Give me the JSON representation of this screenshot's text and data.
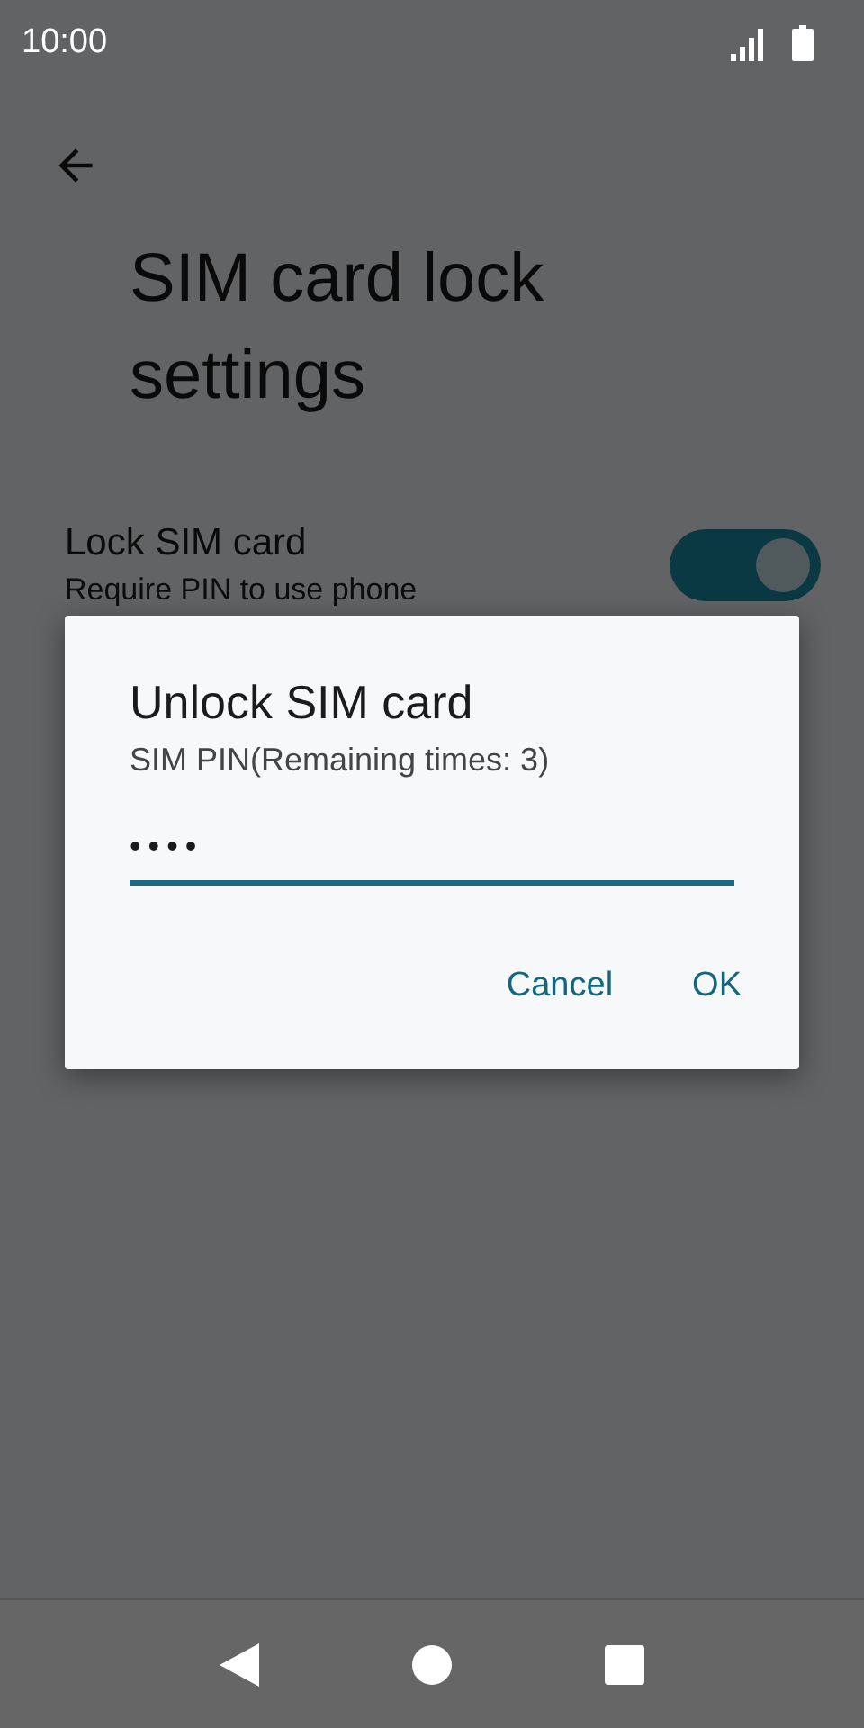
{
  "status_bar": {
    "time": "10:00"
  },
  "page": {
    "title": "SIM card lock settings"
  },
  "settings": [
    {
      "kind": "switch",
      "label": "Lock SIM card",
      "summary": "Require PIN to use phone",
      "on": true
    }
  ],
  "dialog": {
    "title": "Unlock SIM card",
    "message": "SIM PIN(Remaining times: 3)",
    "pin_field": {
      "value": "••••"
    },
    "buttons": [
      "Cancel",
      "OK"
    ]
  }
}
